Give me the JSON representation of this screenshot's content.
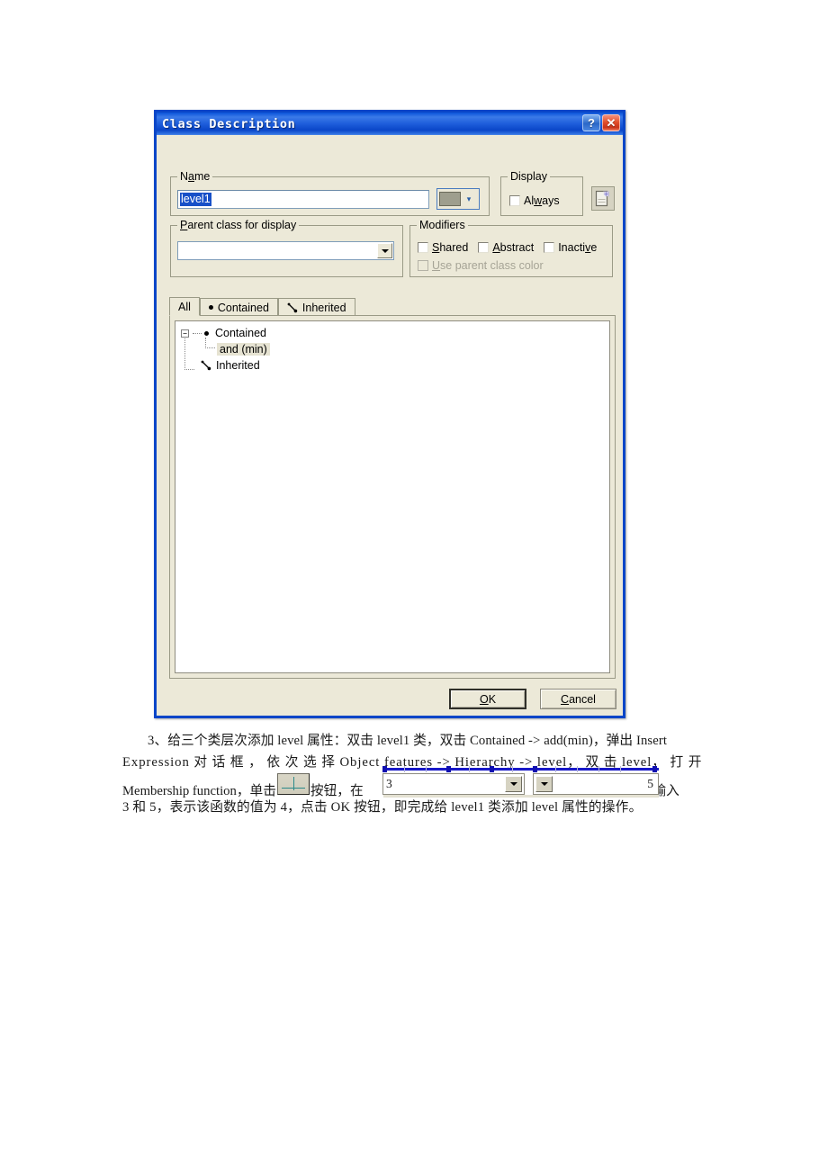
{
  "dialog": {
    "title": "Class Description",
    "titlebar_buttons": [
      {
        "name": "help-button",
        "glyph": "?"
      },
      {
        "name": "close-button",
        "glyph": "✕"
      }
    ],
    "accent_color": "#0a46c8",
    "face_color": "#ece9d8",
    "groups": {
      "name": {
        "legend_pre": "N",
        "legend_underlined": "a",
        "legend_post": "me",
        "input_value": "level1",
        "input_selected": true,
        "color_swatch": "#9e9e8e"
      },
      "parent": {
        "legend_pre": "P",
        "legend_underlined": "P",
        "legend_text": "Parent class for display",
        "combo_value": ""
      },
      "display": {
        "legend": "Display",
        "checkbox_label_pre": "Al",
        "checkbox_label_underlined": "w",
        "checkbox_label_post": "ays",
        "checkbox_label": "Always",
        "checked": false
      },
      "modifiers": {
        "legend": "Modifiers",
        "items": [
          {
            "label": "Shared",
            "checked": false,
            "disabled": false
          },
          {
            "label": "Abstract",
            "checked": false,
            "disabled": false
          },
          {
            "label": "Inactive",
            "checked": false,
            "disabled": false
          },
          {
            "label": "Use parent class color",
            "checked": false,
            "disabled": true
          }
        ]
      }
    },
    "tabs": [
      {
        "label": "All",
        "icon": "none",
        "active": true
      },
      {
        "label": "Contained",
        "icon": "dot-icon",
        "active": false
      },
      {
        "label": "Inherited",
        "icon": "inherited-arrow-icon",
        "active": false
      }
    ],
    "tree": [
      {
        "label": "Contained",
        "level": 1,
        "expander": "−",
        "icon": "dot-icon",
        "selected": false
      },
      {
        "label": "and (min)",
        "level": 2,
        "expander": "",
        "icon": "none",
        "selected": true
      },
      {
        "label": "Inherited",
        "level": 1,
        "expander": "",
        "icon": "inherited-arrow-icon",
        "selected": false
      }
    ],
    "buttons": [
      {
        "name": "ok-button",
        "label_pre": "",
        "label": "OK",
        "default": true
      },
      {
        "name": "cancel-button",
        "label": "Cancel",
        "default": false
      }
    ],
    "doc_icon": "page-sparkle-icon"
  },
  "prose": {
    "line1": "3、给三个类层次添加 level 属性：双击 level1 类，双击 Contained -> add(min)，弹出 Insert",
    "line2": "Expression 对 话 框 ， 依 次 选 择 Object features -> Hierarchy -> level， 双 击 level， 打 开",
    "line3_before": "Membership function，单击",
    "line3_mid": "按钮，在",
    "line3_after": "处输入",
    "line4": "3 和 5，表示该函数的值为 4，点击 OK 按钮，即完成给 level1 类添加 level 属性的操作。"
  },
  "inline_widget": {
    "slider_color": "#1818c8",
    "left_combo_value": "3",
    "right_combo_value": "5",
    "mf_button_icon": "membership-function-axes-icon"
  }
}
